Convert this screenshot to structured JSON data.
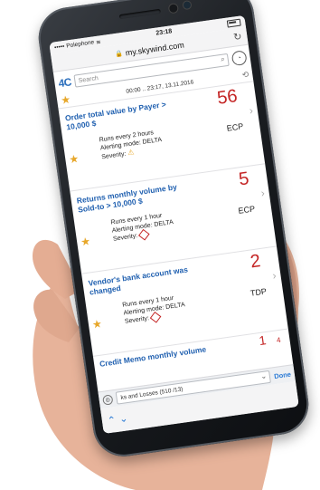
{
  "status": {
    "carrier": "Polephone",
    "time": "23:18"
  },
  "browser": {
    "url": "my.skywind.com"
  },
  "app": {
    "logo": "4C",
    "search_placeholder": "Search",
    "range": "00:00 .. 23:17, 13.11.2016"
  },
  "cards": [
    {
      "title": "Order total value by Payer > 10,000 $",
      "count": "56",
      "runs": "Runs every 2 hours",
      "mode": "Alerting mode: DELTA",
      "severity_label": "Severity:",
      "severity_icon": "warning-icon",
      "system": "ECP"
    },
    {
      "title": "Returns monthly volume by Sold-to > 10,000 $",
      "count": "5",
      "runs": "Runs every 1 hour",
      "mode": "Alerting mode: DELTA",
      "severity_label": "Severity:",
      "severity_icon": "high-severity-icon",
      "system": "ECP"
    },
    {
      "title": "Vendor's bank account was changed",
      "count": "2",
      "runs": "Runs every 1 hour",
      "mode": "Alerting mode: DELTA",
      "severity_label": "Severity:",
      "severity_icon": "high-severity-icon",
      "system": "TDP"
    }
  ],
  "partial_card": {
    "title": "Credit Memo monthly volume",
    "count": "1",
    "count2": "4"
  },
  "picker": {
    "value": "ks and Losses (510 /13)",
    "done_label": "Done"
  },
  "colors": {
    "accent": "#2060b0",
    "alert": "#c42525",
    "star": "#e7a72a"
  }
}
